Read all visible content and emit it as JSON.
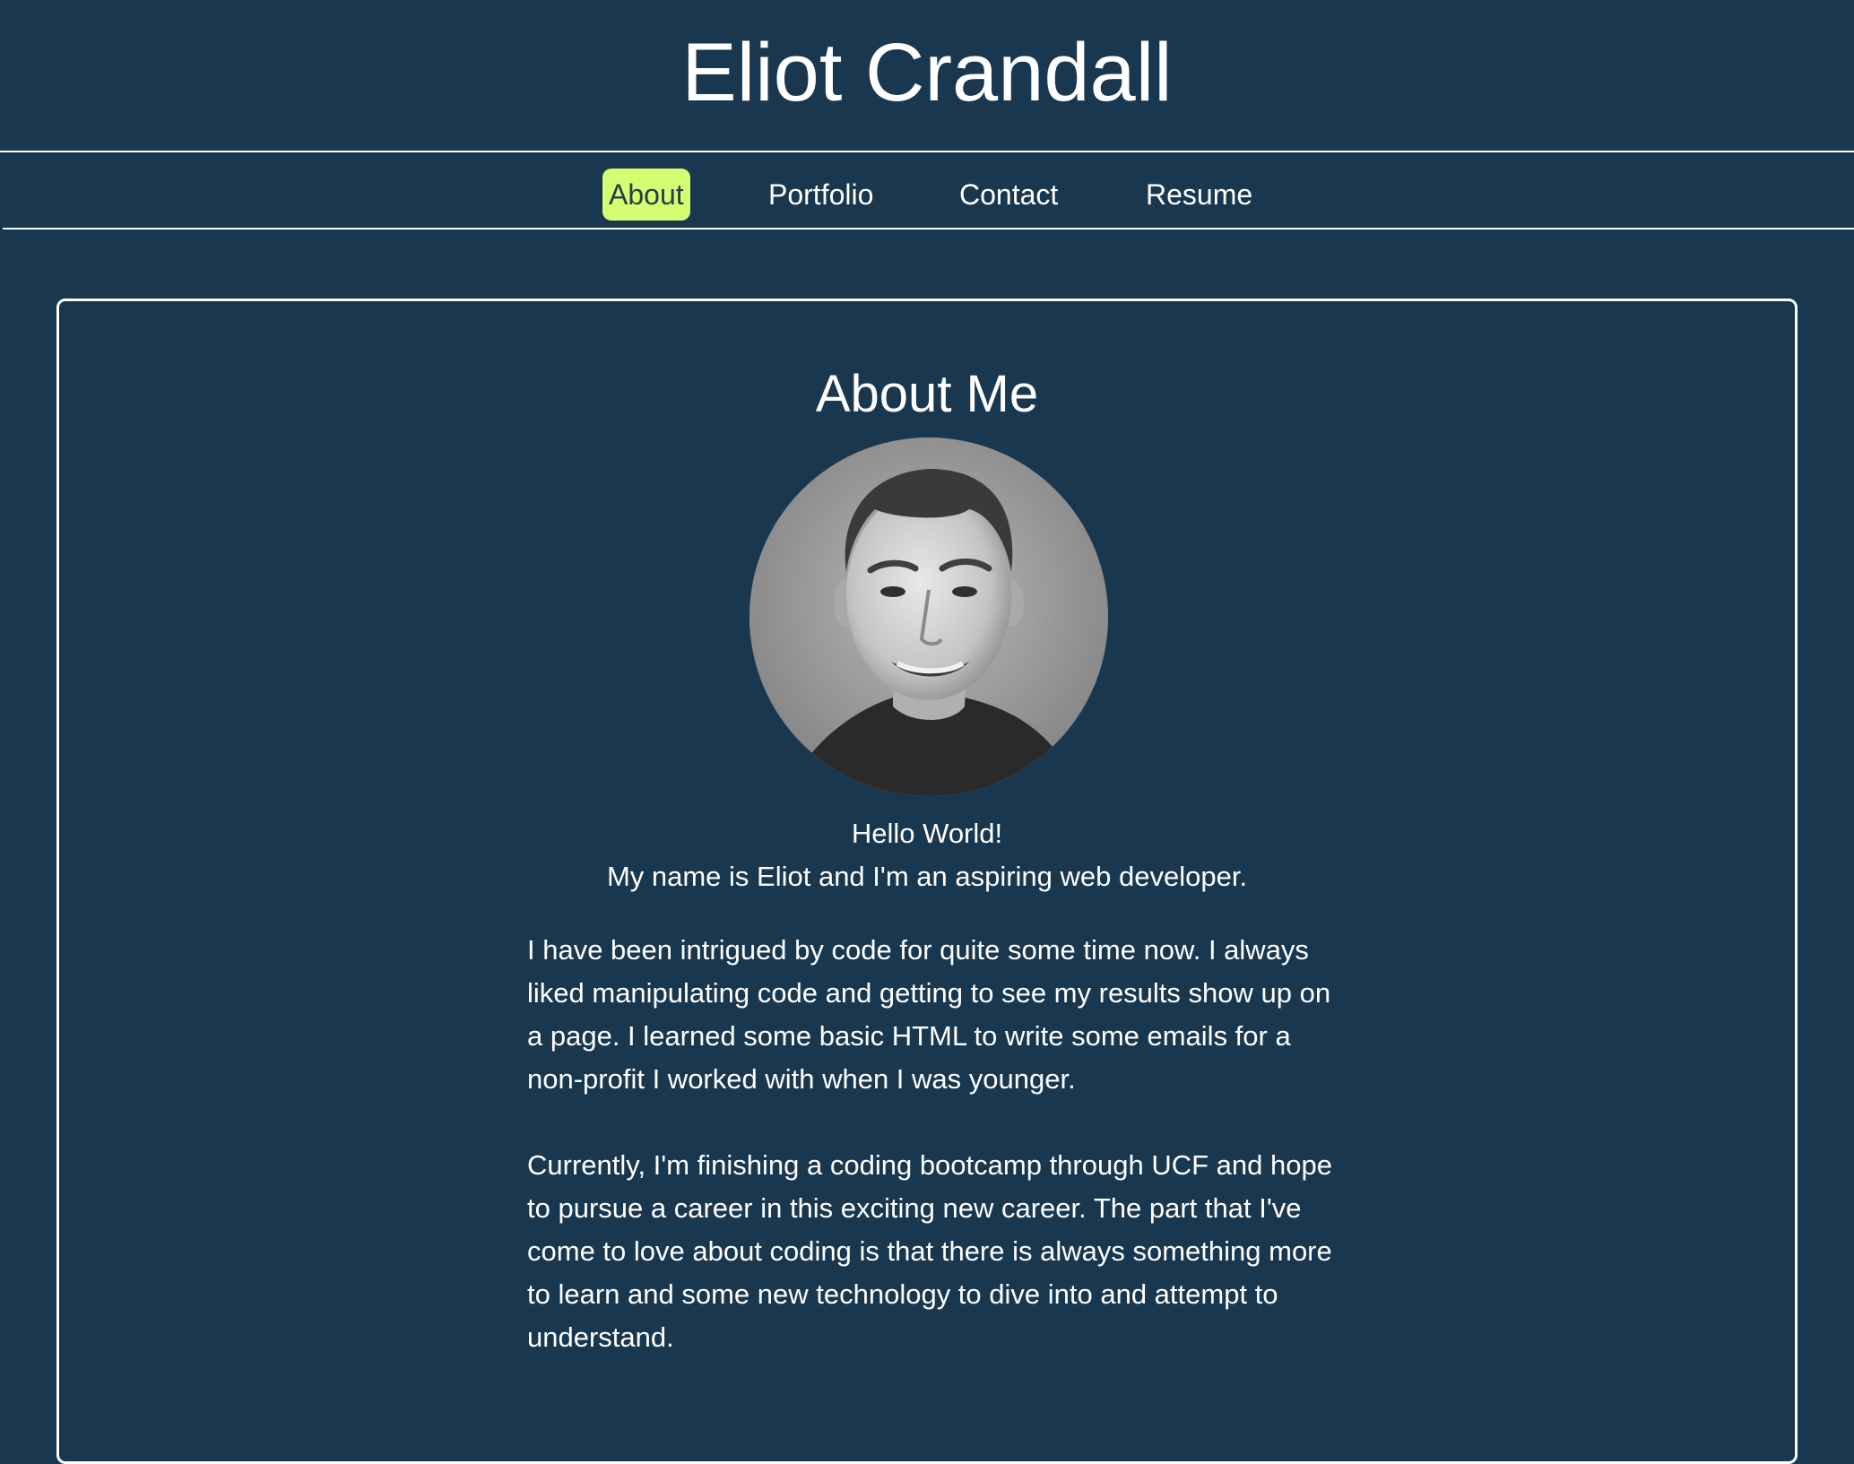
{
  "header": {
    "title": "Eliot Crandall"
  },
  "nav": {
    "items": [
      {
        "label": "About",
        "active": true
      },
      {
        "label": "Portfolio",
        "active": false
      },
      {
        "label": "Contact",
        "active": false
      },
      {
        "label": "Resume",
        "active": false
      }
    ]
  },
  "about": {
    "heading": "About Me",
    "avatar_icon": "portrait-photo",
    "greeting_line1": "Hello World!",
    "greeting_line2": "My name is Eliot and I'm an aspiring web developer.",
    "paragraphs": [
      "I have been intrigued by code for quite some time now. I always liked manipulating code and getting to see my results show up on a page. I learned some basic HTML to write some emails for a non-profit I worked with when I was younger.",
      "Currently, I'm finishing a coding bootcamp through UCF and hope to pursue a career in this exciting new career. The part that I've come to love about coding is that there is always something more to learn and some new technology to dive into and attempt to understand."
    ]
  },
  "colors": {
    "background": "#19374f",
    "text": "#ffffff",
    "nav_active_bg": "#d4ff72",
    "nav_active_text": "#2d3b46"
  }
}
